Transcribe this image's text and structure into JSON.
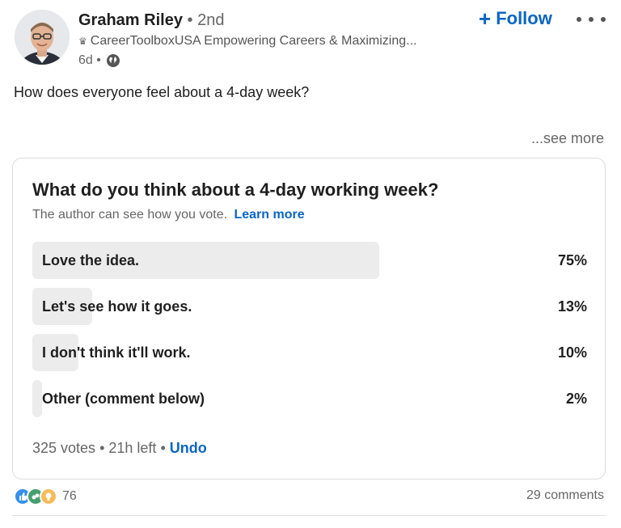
{
  "author": {
    "name": "Graham Riley",
    "degree": "• 2nd",
    "headline": "CareerToolboxUSA Empowering Careers & Maximizing...",
    "time": "6d •"
  },
  "actions": {
    "follow_label": "Follow",
    "follow_icon": "plus-icon",
    "more_icon": "more-options-icon"
  },
  "post": {
    "text": "How does everyone feel about a 4-day week?",
    "see_more": "...see more"
  },
  "poll": {
    "question": "What do you think about a 4-day working week?",
    "note": "The author can see how you vote.",
    "learn_more": "Learn more",
    "options": [
      {
        "label": "Love the idea.",
        "percent": "75%",
        "value": 75
      },
      {
        "label": "Let's see how it goes.",
        "percent": "13%",
        "value": 13
      },
      {
        "label": "I don't think it'll work.",
        "percent": "10%",
        "value": 10
      },
      {
        "label": "Other (comment below)",
        "percent": "2%",
        "value": 2
      }
    ],
    "votes": "325 votes",
    "time_left": "21h left",
    "undo": "Undo"
  },
  "social": {
    "reaction_count": "76",
    "reaction_icons": [
      "like-icon",
      "celebrate-icon",
      "insightful-icon"
    ],
    "comments": "29 comments"
  },
  "colors": {
    "accent": "#0a66c2",
    "bar": "#ececec",
    "text_secondary": "#666666"
  }
}
